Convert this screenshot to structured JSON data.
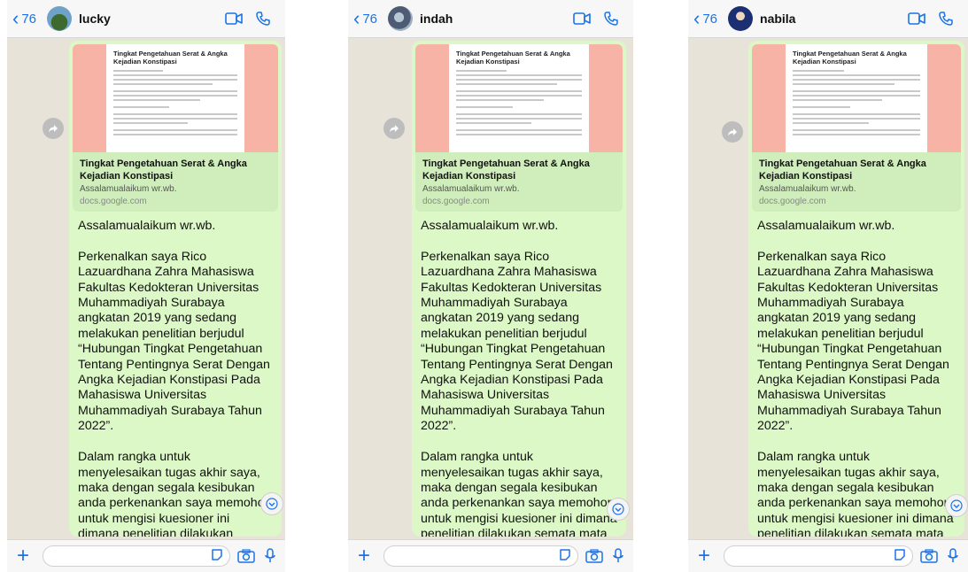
{
  "phones": [
    {
      "back_count": "76",
      "contact_name": "lucky",
      "preview": {
        "doc_title": "Tingkat Pengetahuan Serat & Angka Kejadian Konstipasi",
        "title": "Tingkat Pengetahuan Serat & Angka Kejadian Konstipasi",
        "description": "Assalamualaikum wr.wb.",
        "domain": "docs.google.com"
      },
      "message": "Assalamualaikum wr.wb.\n\nPerkenalkan saya Rico Lazuardhana Zahra Mahasiswa Fakultas Kedokteran Universitas Muhammadiyah Surabaya angkatan 2019 yang sedang melakukan penelitian berjudul “Hubungan Tingkat Pengetahuan Tentang Pentingnya Serat Dengan Angka Kejadian Konstipasi Pada Mahasiswa Universitas Muhammadiyah Surabaya Tahun 2022”.\n\nDalam rangka untuk menyelesaikan tugas akhir saya, maka dengan segala kesibukan anda perkenankan saya memohon untuk mengisi kuesioner ini dimana penelitian dilakukan semata mata untuk kepentingan ilmiah, sehingga jawaban jujur dari anda"
    },
    {
      "back_count": "76",
      "contact_name": "indah",
      "preview": {
        "doc_title": "Tingkat Pengetahuan Serat & Angka Kejadian Konstipasi",
        "title": "Tingkat Pengetahuan Serat & Angka Kejadian Konstipasi",
        "description": "Assalamualaikum wr.wb.",
        "domain": "docs.google.com"
      },
      "message": "Assalamualaikum wr.wb.\n\nPerkenalkan saya Rico Lazuardhana Zahra Mahasiswa Fakultas Kedokteran Universitas Muhammadiyah Surabaya angkatan 2019 yang sedang melakukan penelitian berjudul “Hubungan Tingkat Pengetahuan Tentang Pentingnya Serat Dengan Angka Kejadian Konstipasi Pada Mahasiswa Universitas Muhammadiyah Surabaya Tahun 2022”.\n\nDalam rangka untuk menyelesaikan tugas akhir saya, maka dengan segala kesibukan anda perkenankan saya memohon untuk mengisi kuesioner ini dimana penelitian dilakukan semata mata untuk kepentingan ilmiah, sehingga jawaban jujur dari anda"
    },
    {
      "back_count": "76",
      "contact_name": "nabila",
      "preview": {
        "doc_title": "Tingkat Pengetahuan Serat & Angka Kejadian Konstipasi",
        "title": "Tingkat Pengetahuan Serat & Angka Kejadian Konstipasi",
        "description": "Assalamualaikum wr.wb.",
        "domain": "docs.google.com"
      },
      "message": "Assalamualaikum wr.wb.\n\nPerkenalkan saya Rico Lazuardhana Zahra Mahasiswa Fakultas Kedokteran Universitas Muhammadiyah Surabaya angkatan 2019 yang sedang melakukan penelitian berjudul “Hubungan Tingkat Pengetahuan Tentang Pentingnya Serat Dengan Angka Kejadian Konstipasi Pada Mahasiswa Universitas Muhammadiyah Surabaya Tahun 2022”.\n\nDalam rangka untuk menyelesaikan tugas akhir saya, maka dengan segala kesibukan anda perkenankan saya memohon untuk mengisi kuesioner ini dimana penelitian dilakukan semata mata untuk kepentingan ilmiah, sehingga jawaban jujur dari anda"
    }
  ],
  "colors": {
    "accent": "#1a73e8",
    "bubble": "#dcf8c6",
    "chat_background": "#e8e3d9",
    "preview_banner": "#f6b3a6"
  },
  "icons": {
    "back": "chevron-left-icon",
    "video": "video-camera-icon",
    "phone": "phone-icon",
    "forward": "forward-icon",
    "scroll": "chevron-down-icon",
    "attach": "plus-icon",
    "sticker": "sticker-icon",
    "camera": "camera-icon",
    "mic": "microphone-icon"
  }
}
